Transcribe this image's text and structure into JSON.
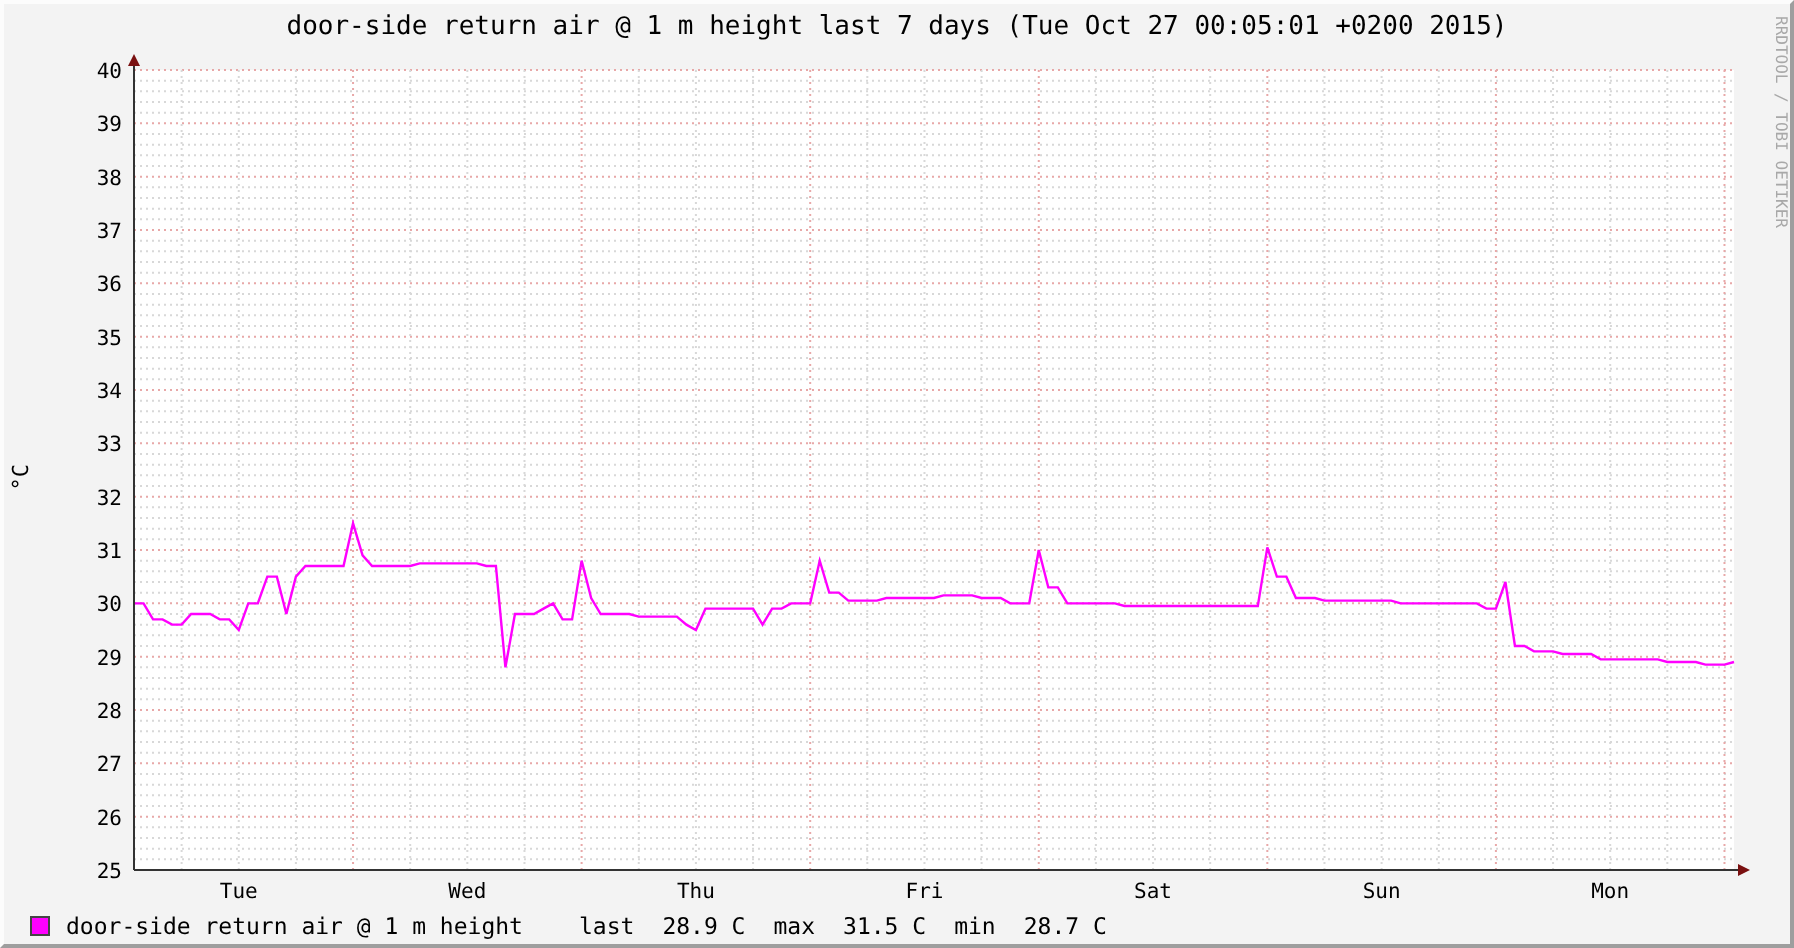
{
  "graph": {
    "title": "door-side return air @ 1 m height last 7 days (Tue Oct 27 00:05:01 +0200 2015)",
    "y_axis_label": "°C",
    "vertical_note": "RRDTOOL / TOBI OETIKER",
    "chart_data": {
      "type": "line",
      "grid": true,
      "ylim": [
        25,
        40
      ],
      "categories": [
        null,
        null,
        null,
        null,
        null,
        null,
        null,
        null,
        null,
        null,
        null,
        "Tue",
        null,
        null,
        null,
        null,
        null,
        null,
        null,
        null,
        null,
        null,
        null,
        null,
        null,
        null,
        null,
        null,
        null,
        null,
        null,
        null,
        null,
        null,
        null,
        "Wed",
        null,
        null,
        null,
        null,
        null,
        null,
        null,
        null,
        null,
        null,
        null,
        null,
        null,
        null,
        null,
        null,
        null,
        null,
        null,
        null,
        null,
        null,
        null,
        "Thu",
        null,
        null,
        null,
        null,
        null,
        null,
        null,
        null,
        null,
        null,
        null,
        null,
        null,
        null,
        null,
        null,
        null,
        null,
        null,
        null,
        null,
        null,
        null,
        "Fri",
        null,
        null,
        null,
        null,
        null,
        null,
        null,
        null,
        null,
        null,
        null,
        null,
        null,
        null,
        null,
        null,
        null,
        null,
        null,
        null,
        null,
        null,
        null,
        "Sat",
        null,
        null,
        null,
        null,
        null,
        null,
        null,
        null,
        null,
        null,
        null,
        null,
        null,
        null,
        null,
        null,
        null,
        null,
        null,
        null,
        null,
        null,
        null,
        "Sun",
        null,
        null,
        null,
        null,
        null,
        null,
        null,
        null,
        null,
        null,
        null,
        null,
        null,
        null,
        null,
        null,
        null,
        null,
        null,
        null,
        null,
        null,
        null,
        "Mon",
        null,
        null,
        null,
        null,
        null,
        null,
        null,
        null,
        null,
        null,
        null,
        null,
        null
      ],
      "series": [
        {
          "name": "door-side return air @ 1 m height",
          "color": "#ff00ff",
          "values": [
            30.0,
            30.0,
            29.7,
            29.7,
            29.6,
            29.6,
            29.8,
            29.8,
            29.8,
            29.7,
            29.7,
            29.5,
            30.0,
            30.0,
            30.5,
            30.5,
            29.8,
            30.5,
            30.7,
            30.7,
            30.7,
            30.7,
            30.7,
            31.5,
            30.9,
            30.7,
            30.7,
            30.7,
            30.7,
            30.7,
            30.75,
            30.75,
            30.75,
            30.75,
            30.75,
            30.75,
            30.75,
            30.7,
            30.7,
            28.8,
            29.8,
            29.8,
            29.8,
            29.9,
            30.0,
            29.7,
            29.7,
            30.8,
            30.1,
            29.8,
            29.8,
            29.8,
            29.8,
            29.75,
            29.75,
            29.75,
            29.75,
            29.75,
            29.6,
            29.5,
            29.9,
            29.9,
            29.9,
            29.9,
            29.9,
            29.9,
            29.6,
            29.9,
            29.9,
            30.0,
            30.0,
            30.0,
            30.8,
            30.2,
            30.2,
            30.05,
            30.05,
            30.05,
            30.05,
            30.1,
            30.1,
            30.1,
            30.1,
            30.1,
            30.1,
            30.15,
            30.15,
            30.15,
            30.15,
            30.1,
            30.1,
            30.1,
            30.0,
            30.0,
            30.0,
            31.0,
            30.3,
            30.3,
            30.0,
            30.0,
            30.0,
            30.0,
            30.0,
            30.0,
            29.95,
            29.95,
            29.95,
            29.95,
            29.95,
            29.95,
            29.95,
            29.95,
            29.95,
            29.95,
            29.95,
            29.95,
            29.95,
            29.95,
            29.95,
            31.05,
            30.5,
            30.5,
            30.1,
            30.1,
            30.1,
            30.05,
            30.05,
            30.05,
            30.05,
            30.05,
            30.05,
            30.05,
            30.05,
            30.0,
            30.0,
            30.0,
            30.0,
            30.0,
            30.0,
            30.0,
            30.0,
            30.0,
            29.9,
            29.9,
            30.4,
            29.2,
            29.2,
            29.1,
            29.1,
            29.1,
            29.05,
            29.05,
            29.05,
            29.05,
            28.95,
            28.95,
            28.95,
            28.95,
            28.95,
            28.95,
            28.95,
            28.9,
            28.9,
            28.9,
            28.9,
            28.85,
            28.85,
            28.85,
            28.9
          ]
        }
      ],
      "yticks": [
        25,
        26,
        27,
        28,
        29,
        30,
        31,
        32,
        33,
        34,
        35,
        36,
        37,
        38,
        39,
        40
      ]
    }
  },
  "legend": {
    "stats": [
      {
        "label": "last",
        "value": "28.9 C"
      },
      {
        "label": "max",
        "value": "31.5 C"
      },
      {
        "label": "min",
        "value": "28.7 C"
      }
    ]
  }
}
